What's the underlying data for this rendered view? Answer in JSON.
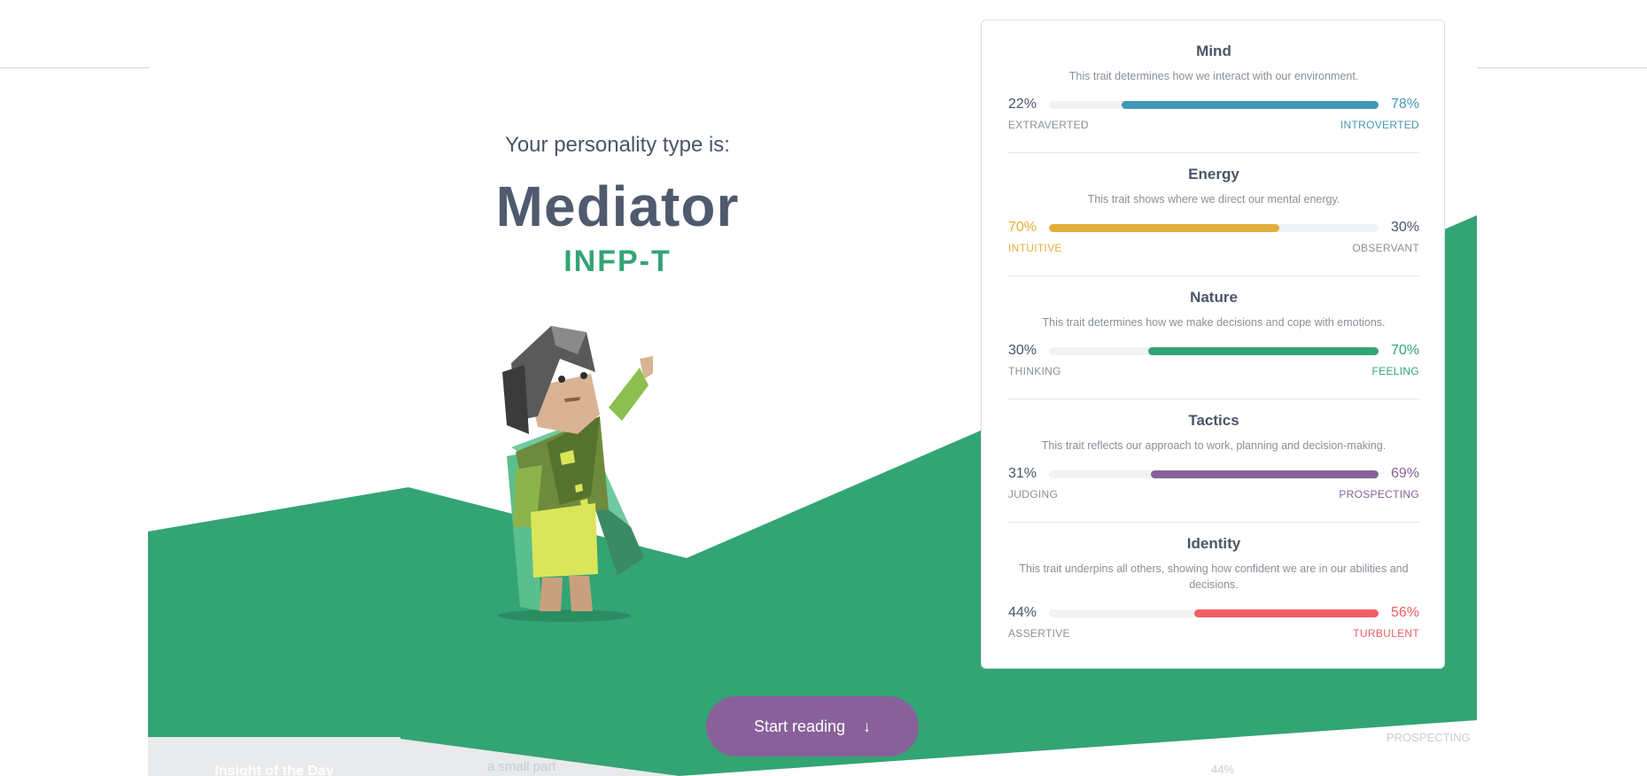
{
  "hero": {
    "intro": "Your personality type is:",
    "type_name": "Mediator",
    "type_code": "INFP-T"
  },
  "colors": {
    "green": "#33a474",
    "blue": "#4298b4",
    "yellow": "#e4ae3a",
    "purple": "#88619a",
    "red": "#f25e62",
    "dark_text": "#4a5568"
  },
  "traits": [
    {
      "title": "Mind",
      "description": "This trait determines how we interact with our environment.",
      "left_pct": "22%",
      "right_pct": "78%",
      "left_label": "Extraverted",
      "right_label": "Introverted",
      "dominant": "right",
      "dominant_value": 78,
      "color": "#4298b4"
    },
    {
      "title": "Energy",
      "description": "This trait shows where we direct our mental energy.",
      "left_pct": "70%",
      "right_pct": "30%",
      "left_label": "Intuitive",
      "right_label": "Observant",
      "dominant": "left",
      "dominant_value": 70,
      "color": "#e4ae3a"
    },
    {
      "title": "Nature",
      "description": "This trait determines how we make decisions and cope with emotions.",
      "left_pct": "30%",
      "right_pct": "70%",
      "left_label": "Thinking",
      "right_label": "Feeling",
      "dominant": "right",
      "dominant_value": 70,
      "color": "#33a474"
    },
    {
      "title": "Tactics",
      "description": "This trait reflects our approach to work, planning and decision-making.",
      "left_pct": "31%",
      "right_pct": "69%",
      "left_label": "Judging",
      "right_label": "Prospecting",
      "dominant": "right",
      "dominant_value": 69,
      "color": "#88619a"
    },
    {
      "title": "Identity",
      "description": "This trait underpins all others, showing how confident we are in our abilities and decisions.",
      "left_pct": "44%",
      "right_pct": "56%",
      "left_label": "Assertive",
      "right_label": "Turbulent",
      "dominant": "right",
      "dominant_value": 56,
      "color": "#f25e62"
    }
  ],
  "cta": {
    "label": "Start reading",
    "icon": "arrow-down-icon"
  },
  "below_fold": {
    "insight_tab": "Insight of the Day",
    "snippet": "a small part",
    "ghost_label": "PROSPECTING",
    "ghost_pct": "44%"
  }
}
